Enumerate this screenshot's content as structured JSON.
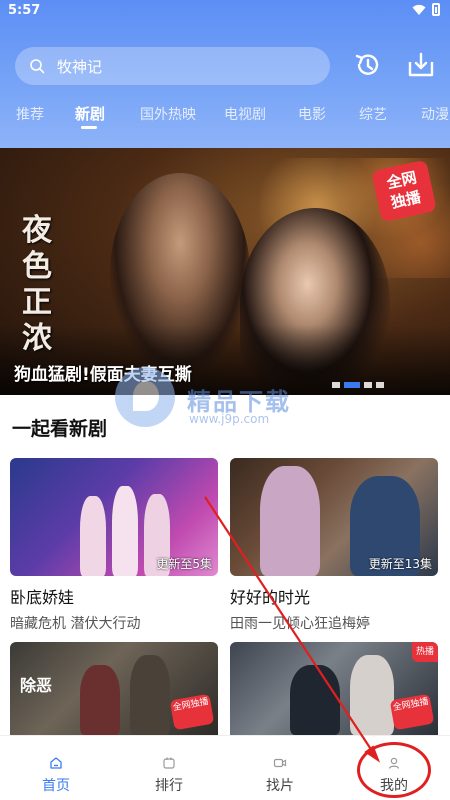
{
  "status_bar": {
    "time": "5:57"
  },
  "search": {
    "query": "牧神记"
  },
  "header": {
    "history_icon": "history-icon",
    "download_icon": "download-icon"
  },
  "tabs": [
    {
      "label": "推荐",
      "active": false
    },
    {
      "label": "新剧",
      "active": true
    },
    {
      "label": "国外热映",
      "active": false
    },
    {
      "label": "电视剧",
      "active": false
    },
    {
      "label": "电影",
      "active": false
    },
    {
      "label": "综艺",
      "active": false
    },
    {
      "label": "动漫",
      "active": false
    }
  ],
  "banner": {
    "title": "狗血猛剧!假面夫妻互撕",
    "calligraphy": "夜色正浓",
    "badge": "全网独播",
    "page_count": 4,
    "active_page": 1
  },
  "watermark": {
    "text": "精品下载",
    "url": "www.j9p.com"
  },
  "section": {
    "title": "一起看新剧",
    "cards": [
      {
        "title": "卧底娇娃",
        "subtitle": "暗藏危机 潜伏大行动",
        "badge": "更新至5集"
      },
      {
        "title": "好好的时光",
        "subtitle": "田雨一见倾心狂追梅婷",
        "badge": "更新至13集"
      },
      {
        "title": "",
        "subtitle": "",
        "badge": "",
        "poster_text": "除恶",
        "corner_badge": "全网独播"
      },
      {
        "title": "",
        "subtitle": "",
        "badge": "",
        "corner_badge": "全网独播",
        "hot_tag": "热播"
      }
    ]
  },
  "bottom_nav": [
    {
      "label": "首页",
      "icon": "home-icon",
      "active": true
    },
    {
      "label": "排行",
      "icon": "ranking-icon",
      "active": false
    },
    {
      "label": "找片",
      "icon": "video-icon",
      "active": false
    },
    {
      "label": "我的",
      "icon": "user-icon",
      "active": false
    }
  ],
  "colors": {
    "accent": "#3a7cf0",
    "header_top": "#5c8ef5",
    "badge_red": "#e8323b",
    "annotation_red": "#e02020"
  }
}
